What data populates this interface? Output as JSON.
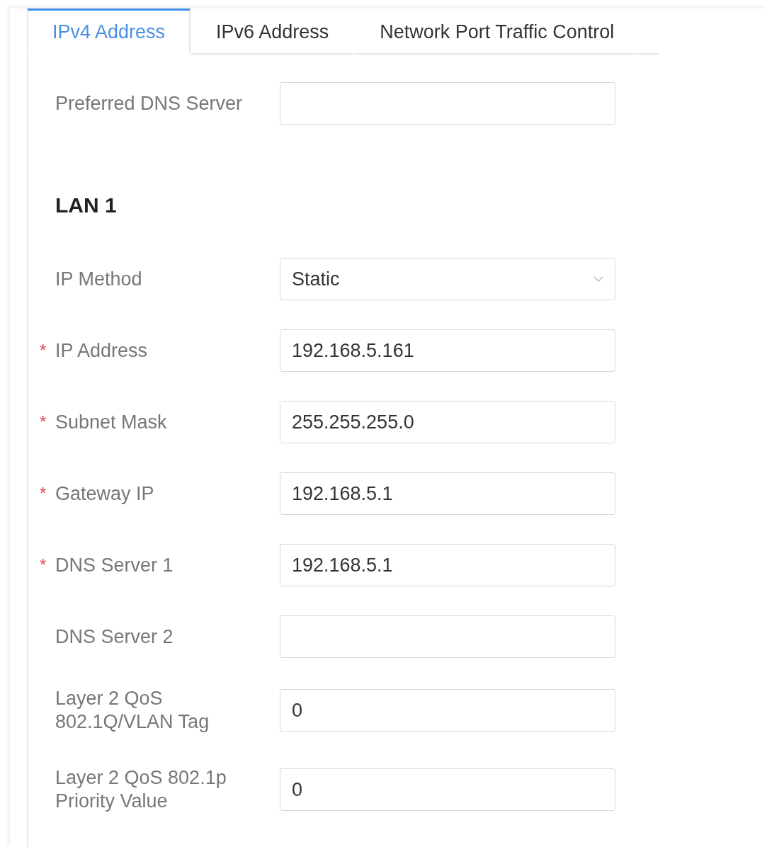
{
  "tabs": [
    {
      "label": "IPv4 Address",
      "selected": true
    },
    {
      "label": "IPv6 Address",
      "selected": false
    },
    {
      "label": "Network Port Traffic Control",
      "selected": false
    }
  ],
  "top_fields": [
    {
      "label": "Preferred DNS Server",
      "kind": "text"
    }
  ],
  "section": {
    "title": "LAN 1",
    "fields": [
      {
        "label": "IP Method",
        "kind": "select",
        "value": "Static"
      },
      {
        "label": "IP Address",
        "kind": "text",
        "required_mark": "*",
        "value": "192.168.5.161"
      },
      {
        "label": "Subnet Mask",
        "kind": "text",
        "required_mark": "*",
        "value": "255.255.255.0"
      },
      {
        "label": "Gateway IP",
        "kind": "text",
        "required_mark": "*",
        "value": "192.168.5.1"
      },
      {
        "label": "DNS Server 1",
        "kind": "text",
        "required_mark": "*",
        "value": "192.168.5.1"
      },
      {
        "label": "DNS Server 2",
        "kind": "text"
      },
      {
        "label": "Layer 2 QoS 802.1Q/VLAN Tag",
        "kind": "text",
        "value": "0"
      },
      {
        "label": "Layer 2 QoS 802.1p Priority Value",
        "kind": "text",
        "value": "0"
      }
    ]
  }
}
